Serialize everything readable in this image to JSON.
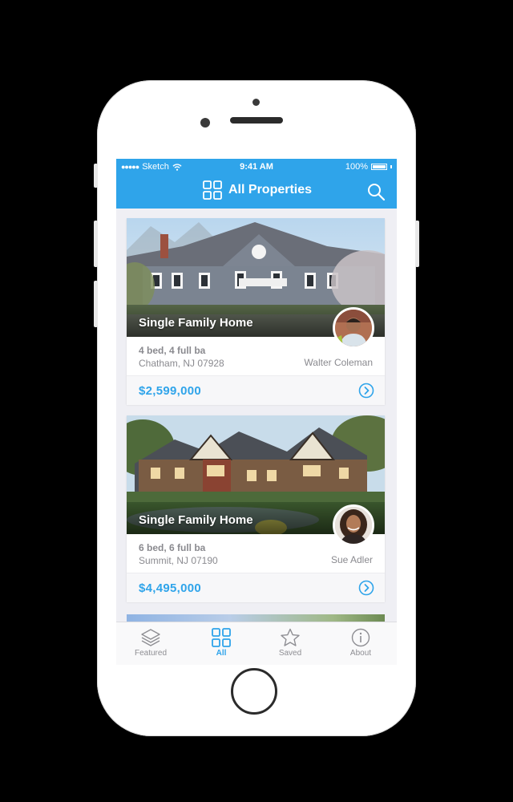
{
  "status_bar": {
    "signal_dots": "●●●●●",
    "carrier": "Sketch",
    "time": "9:41 AM",
    "battery": "100%"
  },
  "nav": {
    "title": "All Properties",
    "icons": [
      "grid-icon",
      "search-icon"
    ]
  },
  "listings": [
    {
      "title": "Single Family Home",
      "beds_baths": "4 bed, 4 full ba",
      "location": "Chatham, NJ 07928",
      "agent": "Walter Coleman",
      "price": "$2,599,000"
    },
    {
      "title": "Single Family Home",
      "beds_baths": "6 bed, 6 full ba",
      "location": "Summit, NJ 07190",
      "agent": "Sue Adler",
      "price": "$4,495,000"
    }
  ],
  "tabs": [
    {
      "label": "Featured",
      "icon": "layers-icon",
      "active": false
    },
    {
      "label": "All",
      "icon": "grid-icon",
      "active": true
    },
    {
      "label": "Saved",
      "icon": "star-icon",
      "active": false
    },
    {
      "label": "About",
      "icon": "info-icon",
      "active": false
    }
  ],
  "colors": {
    "accent": "#2fa4ea",
    "background": "#efeff4",
    "muted_text": "#8a8a8f"
  }
}
